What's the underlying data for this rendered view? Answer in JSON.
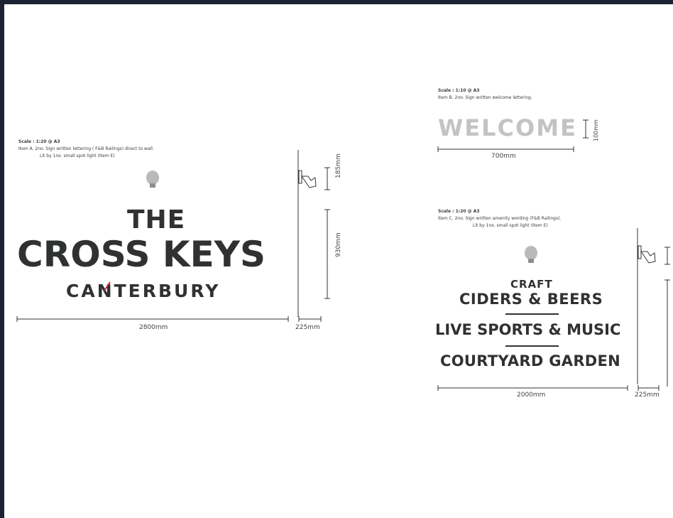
{
  "item_a": {
    "scale": "Scale : 1:20 @ A3",
    "note1": "Item A. 2no. Sign written lettering ( F&B Railings) direct to wall.",
    "note2": "Lit by 1no. small spot light (Item E)",
    "line_the": "THE",
    "line_main": "CROSS KEYS",
    "line_town": "CANTERBURY",
    "dim_width": "2800mm",
    "dim_depth": "225mm",
    "dim_light": "185mm",
    "dim_height": "930mm"
  },
  "item_b": {
    "scale": "Scale : 1:10 @ A3",
    "note1": "Item B. 2no. Sign written welcome lettering.",
    "word": "WELCOME",
    "dim_width": "700mm",
    "dim_height": "100mm"
  },
  "item_c": {
    "scale": "Scale : 1:20 @ A3",
    "note1": "Item C. 2no. Sign written amenity wording (F&B Railings).",
    "note2": "Lit by 1no. small spot light (Item E)",
    "line1": "CRAFT",
    "line2": "CIDERS & BEERS",
    "line3": "LIVE SPORTS & MUSIC",
    "line4": "COURTYARD GARDEN",
    "dim_width": "2000mm",
    "dim_depth": "225mm"
  },
  "colors": {
    "background": "#1b2233",
    "sheet": "#ffffff",
    "lettering": "#2f3133",
    "welcome": "#c3c3c3",
    "accent": "#c0262d"
  }
}
